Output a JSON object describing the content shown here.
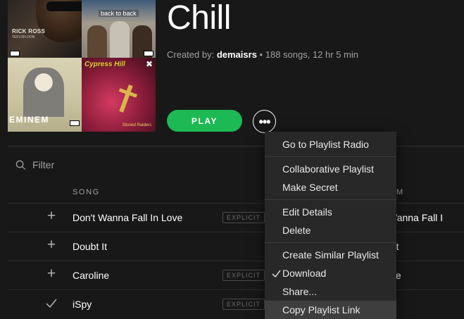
{
  "playlist": {
    "title": "Chill",
    "created_by_label": "Created by:",
    "owner": "demaisrs",
    "stats": "188 songs, 12 hr 5 min"
  },
  "covers": [
    {
      "artist": "RICK ROSS",
      "subtitle": "TEFLON DON"
    },
    {
      "title": "back to back"
    },
    {
      "artist": "EMINEM"
    },
    {
      "title": "Cypress Hill",
      "subtitle": "Stoned Raiders"
    }
  ],
  "actions": {
    "play_label": "PLAY",
    "more_label": "•••"
  },
  "filter": {
    "placeholder": "Filter"
  },
  "table": {
    "columns": {
      "song": "SONG",
      "album": "M"
    },
    "rows": [
      {
        "song": "Don't Wanna Fall In Love",
        "explicit": "EXPLICIT",
        "album": "Wanna Fall I",
        "saved": false
      },
      {
        "song": "Doubt It",
        "explicit": "",
        "album": "t It",
        "saved": false
      },
      {
        "song": "Caroline",
        "explicit": "EXPLICIT",
        "album": "ine",
        "saved": false
      },
      {
        "song": "iSpy",
        "explicit": "EXPLICIT",
        "album": "",
        "saved": true
      }
    ]
  },
  "context_menu": {
    "groups": [
      [
        {
          "label": "Go to Playlist Radio"
        }
      ],
      [
        {
          "label": "Collaborative Playlist"
        },
        {
          "label": "Make Secret"
        }
      ],
      [
        {
          "label": "Edit Details"
        },
        {
          "label": "Delete"
        }
      ],
      [
        {
          "label": "Create Similar Playlist"
        },
        {
          "label": "Download",
          "checked": true
        },
        {
          "label": "Share..."
        },
        {
          "label": "Copy Playlist Link",
          "hovered": true
        }
      ]
    ]
  },
  "colors": {
    "accent": "#1db954",
    "background": "#181818",
    "menu_background": "#282828",
    "menu_hover": "#3e3e3e",
    "muted_text": "#a0a0a0"
  }
}
